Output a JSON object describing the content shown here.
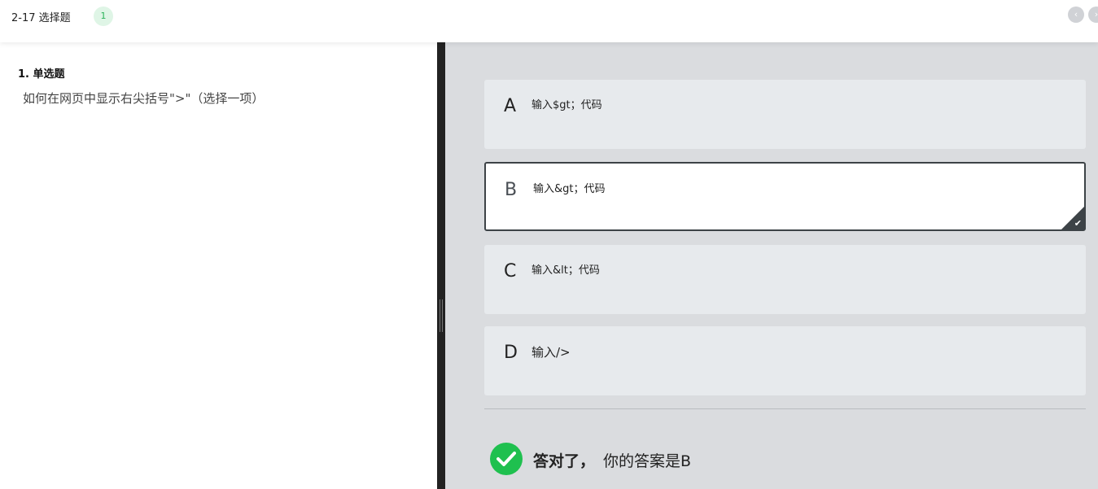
{
  "header": {
    "title": "2-17 选择题",
    "badge_count": "1",
    "prev_label": "‹",
    "next_label": "›"
  },
  "question": {
    "type_label": "1. 单选题",
    "text": "如何在网页中显示右尖括号\">\"（选择一项）"
  },
  "options": [
    {
      "letter": "A",
      "text": "输入$gt；代码",
      "selected": false
    },
    {
      "letter": "B",
      "text": "输入&gt；代码",
      "selected": true
    },
    {
      "letter": "C",
      "text": "输入&lt；代码",
      "selected": false
    },
    {
      "letter": "D",
      "text": "输入/>",
      "selected": false
    }
  ],
  "result": {
    "status": "答对了，",
    "answer_text": "你的答案是B",
    "status_color": "#1fc04f"
  },
  "icons": {
    "check_selected": "checkmark-icon",
    "result_icon": "check-circle-icon"
  }
}
